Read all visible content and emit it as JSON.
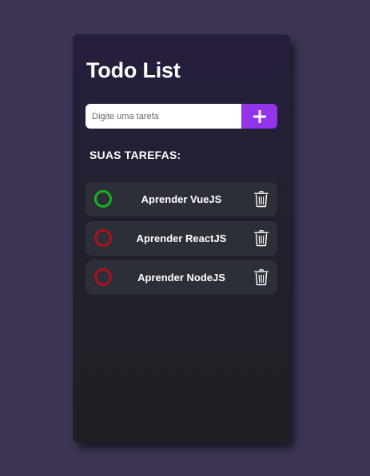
{
  "app": {
    "title": "Todo List"
  },
  "input": {
    "placeholder": "Digite uma tarefa",
    "add_icon": "plus-icon"
  },
  "section": {
    "label": "SUAS TAREFAS:"
  },
  "tasks": [
    {
      "text": "Aprender VueJS",
      "completed": true
    },
    {
      "text": "Aprender ReactJS",
      "completed": false
    },
    {
      "text": "Aprender NodeJS",
      "completed": false
    }
  ],
  "icons": {
    "status": "circle-icon",
    "delete": "trash-icon"
  },
  "colors": {
    "background": "#3e3556",
    "accent": "#9333ea",
    "completed": "#16b51c",
    "pending": "#b0101a",
    "task_bg": "#2c2f38"
  }
}
